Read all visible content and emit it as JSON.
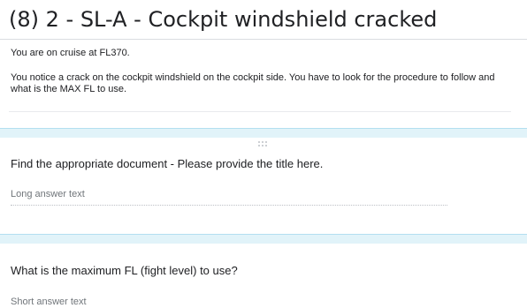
{
  "section": {
    "title": "(8) 2 - SL-A - Cockpit windshield cracked",
    "description_1": "You are on cruise at FL370.",
    "description_2": "You notice a crack on the cockpit windshield on the cockpit side. You have to look for the procedure to follow and what is the MAX FL to use."
  },
  "questions": [
    {
      "title": "Find the appropriate document  -  Please provide the title here.",
      "placeholder": "Long answer text"
    },
    {
      "title": "What is the maximum FL (fight level) to use?",
      "placeholder": "Short answer text"
    }
  ],
  "icons": {
    "drag_handle": "drag-handle-icon"
  },
  "colors": {
    "separator_band": "#e1f3f9",
    "separator_border": "#b3dff0",
    "text_primary": "#202124",
    "text_placeholder": "#70757a"
  }
}
